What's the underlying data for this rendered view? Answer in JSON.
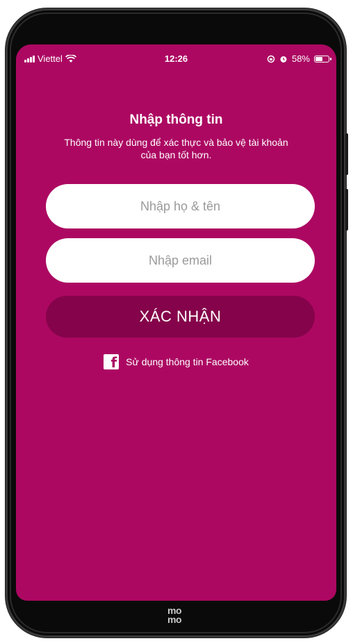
{
  "status_bar": {
    "carrier": "Viettel",
    "time": "12:26",
    "battery": "58%",
    "battery_level": 0.58
  },
  "form": {
    "title": "Nhập thông tin",
    "subtitle": "Thông tin này dùng để xác thực và bảo vệ tài khoản của bạn tốt hơn.",
    "name_placeholder": "Nhập họ & tên",
    "email_placeholder": "Nhập email",
    "confirm_label": "XÁC NHẬN",
    "facebook_label": "Sử dụng thông tin Facebook"
  },
  "brand": {
    "logo_line1": "mo",
    "logo_line2": "mo",
    "background_color": "#ac0862",
    "button_color": "#85034a"
  },
  "icons": {
    "wifi": "wifi-icon",
    "signal": "signal-icon",
    "alarm": "alarm-icon",
    "lock_rotation": "rotation-lock-icon",
    "battery": "battery-icon",
    "facebook": "facebook-icon"
  }
}
